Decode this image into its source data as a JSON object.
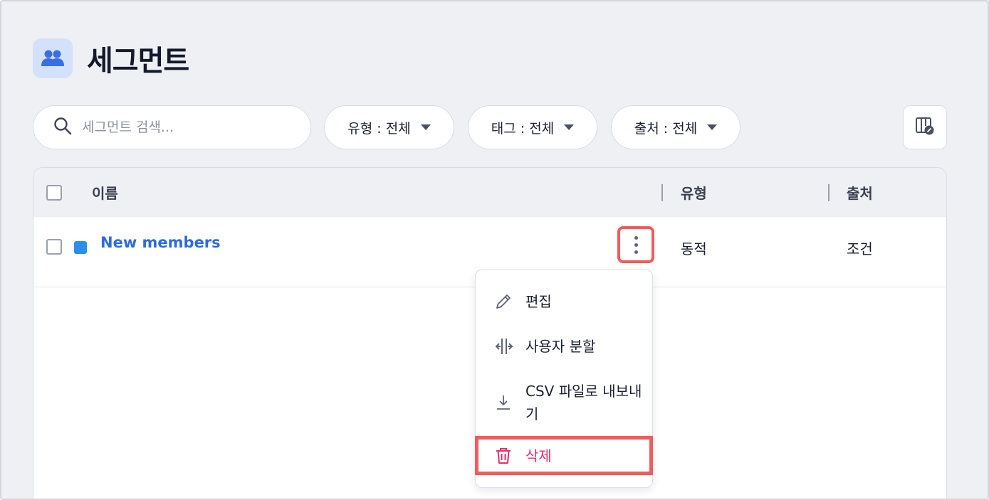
{
  "header": {
    "title": "세그먼트",
    "icon": "users-icon"
  },
  "toolbar": {
    "search_placeholder": "세그먼트 검색...",
    "filters": [
      {
        "label": "유형 : 전체"
      },
      {
        "label": "태그 : 전체"
      },
      {
        "label": "출처 : 전체"
      }
    ],
    "columns_button_icon": "column-settings-icon"
  },
  "table": {
    "columns": [
      "이름",
      "유형",
      "출처"
    ],
    "rows": [
      {
        "name": "New members",
        "type": "동적",
        "source": "조건",
        "color": "#2b8eea"
      }
    ]
  },
  "row_menu": {
    "items": [
      {
        "label": "편집",
        "icon": "pencil-icon"
      },
      {
        "label": "사용자 분할",
        "icon": "split-icon"
      },
      {
        "label": "CSV 파일로 내보내기",
        "icon": "download-icon"
      },
      {
        "label": "삭제",
        "icon": "trash-icon"
      }
    ]
  },
  "colors": {
    "accent": "#2d6be0",
    "highlight": "#f25b5b",
    "danger": "#e6306a",
    "background": "#eef0f4"
  }
}
